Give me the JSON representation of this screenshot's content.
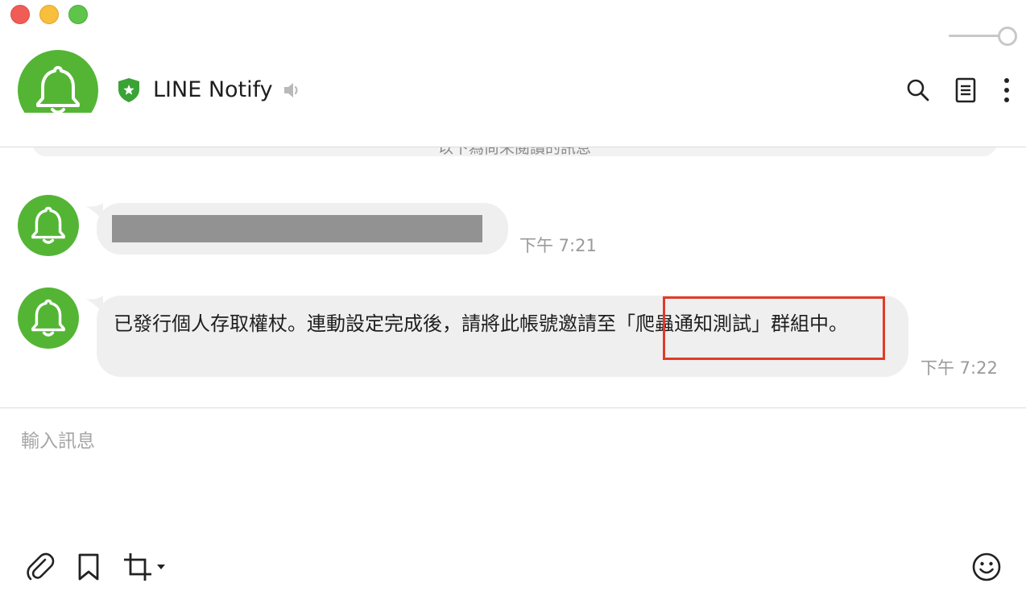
{
  "window": {
    "controls": [
      "close",
      "minimize",
      "zoom"
    ],
    "opacity_slider_level": 1.0
  },
  "header": {
    "title": "LINE Notify",
    "icons": {
      "avatar": "bell-icon",
      "official_badge": "shield-star-icon",
      "sound": "speaker-muted-icon",
      "search": "search-icon",
      "notes": "notes-icon",
      "more": "more-vertical-icon"
    }
  },
  "notice": {
    "text": "以下為尚未閱讀的訊息"
  },
  "messages": [
    {
      "sender_icon": "bell-icon",
      "text": "",
      "redacted": true,
      "time": "下午 7:21"
    },
    {
      "sender_icon": "bell-icon",
      "text": "已發行個人存取權杖。連動設定完成後，請將此帳號邀請至「爬蟲通知測試」群組中。",
      "time": "下午 7:22"
    }
  ],
  "composer": {
    "placeholder": "輸入訊息"
  },
  "toolbar": {
    "icons": {
      "attach": "paperclip-icon",
      "keep": "bookmark-icon",
      "screenshot": "crop-icon",
      "screenshot_menu": "caret-down-icon",
      "emoji": "emoji-icon"
    }
  },
  "colors": {
    "brand_green": "#54b535",
    "bubble_gray": "#efefef",
    "highlight_red": "#e23a28",
    "timestamp_gray": "#9a9a9a"
  }
}
